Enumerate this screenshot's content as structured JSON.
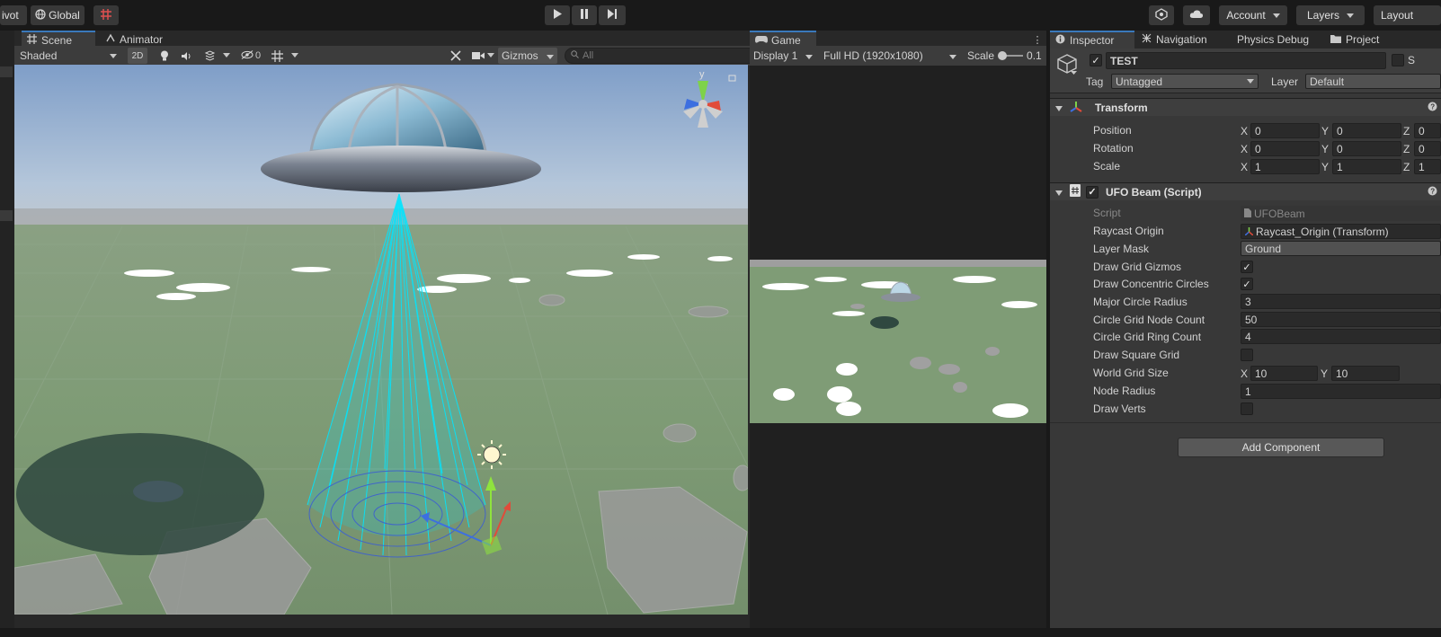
{
  "toolbar": {
    "pivot": "ivot",
    "global": "Global",
    "account": "Account",
    "layers": "Layers",
    "layout": "Layout"
  },
  "scene": {
    "tabs": [
      {
        "label": "Scene"
      },
      {
        "label": "Animator"
      }
    ],
    "shading": "Shaded",
    "mode2d": "2D",
    "hidden_count": "0",
    "gizmos": "Gizmos",
    "search_placeholder": "All"
  },
  "game": {
    "tab": "Game",
    "display": "Display 1",
    "resolution": "Full HD (1920x1080)",
    "scale_label": "Scale",
    "scale_value": "0.1"
  },
  "inspector": {
    "tabs": [
      {
        "label": "Inspector"
      },
      {
        "label": "Navigation"
      },
      {
        "label": "Physics Debug"
      },
      {
        "label": "Project"
      }
    ],
    "object_name": "TEST",
    "static_label": "S",
    "tag_label": "Tag",
    "tag_value": "Untagged",
    "layer_label": "Layer",
    "layer_value": "Default",
    "transform": {
      "title": "Transform",
      "rows": [
        {
          "label": "Position",
          "x": "0",
          "y": "0",
          "z": "0"
        },
        {
          "label": "Rotation",
          "x": "0",
          "y": "0",
          "z": "0"
        },
        {
          "label": "Scale",
          "x": "1",
          "y": "1",
          "z": "1"
        }
      ]
    },
    "script_component": {
      "title": "UFO Beam (Script)",
      "script_label": "Script",
      "script_value": "UFOBeam",
      "raycast_label": "Raycast Origin",
      "raycast_value": "Raycast_Origin (Transform)",
      "layermask_label": "Layer Mask",
      "layermask_value": "Ground",
      "draw_grid_gizmos_label": "Draw Grid Gizmos",
      "draw_grid_gizmos": true,
      "draw_concentric_label": "Draw Concentric Circles",
      "draw_concentric": true,
      "major_radius_label": "Major Circle Radius",
      "major_radius_value": "3",
      "node_count_label": "Circle Grid Node Count",
      "node_count_value": "50",
      "ring_count_label": "Circle Grid Ring Count",
      "ring_count_value": "4",
      "draw_square_label": "Draw Square Grid",
      "draw_square": false,
      "world_grid_label": "World Grid Size",
      "world_grid_x": "10",
      "world_grid_y": "10",
      "node_radius_label": "Node Radius",
      "node_radius_value": "1",
      "draw_verts_label": "Draw Verts",
      "draw_verts": false
    },
    "add_component": "Add Component"
  },
  "axis": {
    "x": "X",
    "y": "Y",
    "z": "Z"
  },
  "gizmo_axis_label": "y",
  "colors": {
    "accent": "#3a79bb",
    "beam": "#00e5ff",
    "ground": "#7f9c76"
  }
}
